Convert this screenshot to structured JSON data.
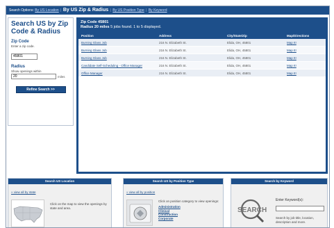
{
  "topbar": {
    "label": "Search Options:",
    "opt1": "By US Location",
    "current": "By US Zip & Radius",
    "opt3": "By US Position Type",
    "opt4": "By Keyword",
    "sep": "|"
  },
  "left": {
    "title": "Search US by Zip Code & Radius",
    "zip_label": "Zip Code",
    "zip_hint": "Enter a zip code.",
    "zip_value": "45801",
    "radius_label": "Radius",
    "radius_hint": "Show openings within",
    "radius_value": "20",
    "radius_unit": "miles",
    "refine_button": "Refine Search >>"
  },
  "results": {
    "zip_line": "Zip Code 45801",
    "radius_line": "Radius 20 miles",
    "summary": "5 jobs found. 1 to 5 displayed.",
    "headers": {
      "position": "Position",
      "address": "Address",
      "city": "City/State/Zip",
      "map": "Map/Directions"
    },
    "rows": [
      {
        "position": "Burning Glass Job",
        "address": "216 N. Elizabeth St.",
        "city": "Elida, OH, 45801",
        "map": "Map It!"
      },
      {
        "position": "Burning Glass Job",
        "address": "216 N. Elizabeth St.",
        "city": "Elida, OH, 45801",
        "map": "Map It!"
      },
      {
        "position": "Burning Glass Job",
        "address": "216 N. Elizabeth St.",
        "city": "Elida, OH, 45801",
        "map": "Map It!"
      },
      {
        "position": "Candidate Self-Scheduling - Office Manager",
        "address": "216 N. Elizabeth St.",
        "city": "Elida, OH, 45801",
        "map": "Map It!"
      },
      {
        "position": "Office Manager",
        "address": "216 N. Elizabeth St.",
        "city": "Elida, OH, 45801",
        "map": "Map It!"
      }
    ]
  },
  "panels": {
    "location": {
      "title": "Search US Location",
      "link": "» view all by state",
      "text": "Click on the map to view the openings by state and area."
    },
    "position": {
      "title": "Search US by Position Type",
      "link": "» view all by position",
      "text": "Click on position category to view openings:",
      "categories": [
        "Administration",
        "Clinical",
        "Construction",
        "Corporate"
      ]
    },
    "keyword": {
      "title": "Search by Keyword",
      "label": "Enter Keyword(s):",
      "text": "Search by job title, location, description and more.",
      "image_text": "SEARCH"
    }
  },
  "colors": {
    "brand": "#1d4f8a",
    "row_alt": "#e9eef5"
  }
}
